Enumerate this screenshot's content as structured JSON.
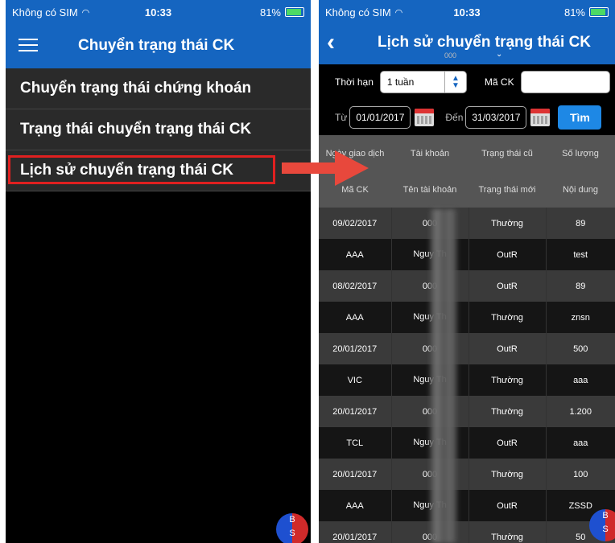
{
  "left_screen": {
    "status": {
      "carrier": "Không có SIM",
      "time": "10:33",
      "battery": "81%"
    },
    "title": "Chuyển trạng thái CK",
    "menu": [
      "Chuyển trạng thái chứng khoán",
      "Trạng thái chuyển trạng thái CK",
      "Lịch sử chuyển trạng thái CK"
    ],
    "badge": {
      "top": "B",
      "bottom": "S"
    }
  },
  "right_screen": {
    "status": {
      "carrier": "Không có SIM",
      "time": "10:33",
      "battery": "81%"
    },
    "title": "Lịch sử chuyển trạng thái CK",
    "account_partial": "000",
    "filters": {
      "period_label": "Thời hạn",
      "period_value": "1 tuần",
      "code_label": "Mã CK",
      "code_value": "",
      "from_label": "Từ",
      "from_date": "01/01/2017",
      "to_label": "Đến",
      "to_date": "31/03/2017",
      "search_button": "Tìm"
    },
    "table": {
      "header_row1": [
        "Ngày giao dịch",
        "Tài khoản",
        "Trạng thái cũ",
        "Số lượng"
      ],
      "header_row2": [
        "Mã CK",
        "Tên tài khoản",
        "Trạng thái mới",
        "Nội dung"
      ],
      "rows": [
        [
          "09/02/2017",
          "000",
          "Thường",
          "89"
        ],
        [
          "AAA",
          "Nguy Th",
          "OutR",
          "test"
        ],
        [
          "08/02/2017",
          "000",
          "OutR",
          "89"
        ],
        [
          "AAA",
          "Nguy Th",
          "Thường",
          "znsn"
        ],
        [
          "20/01/2017",
          "000",
          "OutR",
          "500"
        ],
        [
          "VIC",
          "Nguy Th",
          "Thường",
          "aaa"
        ],
        [
          "20/01/2017",
          "000",
          "Thường",
          "1.200"
        ],
        [
          "TCL",
          "Nguy Th",
          "OutR",
          "aaa"
        ],
        [
          "20/01/2017",
          "000",
          "Thường",
          "100"
        ],
        [
          "AAA",
          "Nguy Th",
          "OutR",
          "ZSSD"
        ],
        [
          "20/01/2017",
          "000",
          "Thường",
          "50"
        ]
      ]
    },
    "badge": {
      "top": "B",
      "bottom": "S"
    }
  },
  "colors": {
    "nav_blue": "#1565c0",
    "highlight_red": "#e02020",
    "button_blue": "#1e88e5"
  }
}
